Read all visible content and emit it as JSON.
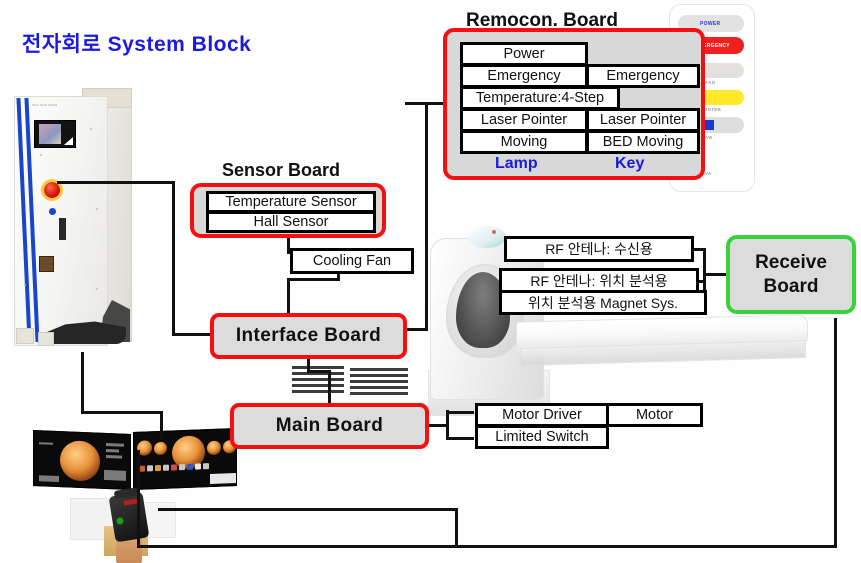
{
  "title": "전자회로 System Block",
  "boards": {
    "remocon": {
      "header": "Remocon. Board",
      "lamp_label": "Lamp",
      "key_label": "Key",
      "rows": [
        {
          "lamp": "Power",
          "key": ""
        },
        {
          "lamp": "Emergency",
          "key": "Emergency"
        },
        {
          "lamp": "Temperature:4-Step",
          "key": ""
        },
        {
          "lamp": "Laser Pointer",
          "key": "Laser Pointer"
        },
        {
          "lamp": "Moving",
          "key": "BED  Moving"
        }
      ]
    },
    "sensor": {
      "header": "Sensor Board",
      "items": [
        "Temperature Sensor",
        "Hall Sensor"
      ]
    },
    "cooling_fan": "Cooling Fan",
    "interface": "Interface Board",
    "main": "Main Board",
    "receive": "Receive\nBoard",
    "receive_line1": "Receive",
    "receive_line2": "Board"
  },
  "rf_group": [
    "RF 안테나: 수신용",
    "RF 안테나: 위치 분석용",
    "위치 분석용 Magnet Sys."
  ],
  "motor_group": {
    "driver": "Motor Driver",
    "motor": "Motor",
    "limit": "Limited Switch"
  },
  "remote_photo": {
    "keys": [
      {
        "text": "POWER",
        "label": ""
      },
      {
        "text": "EMERGENCY",
        "label": ""
      },
      {
        "text": "",
        "label": "COOLING FAN"
      },
      {
        "text": "",
        "label": "LASER POINTER"
      },
      {
        "text": "",
        "label": "TABLE MOVE"
      },
      {
        "text": "",
        "label": "VIVA"
      }
    ]
  },
  "colors": {
    "title_blue": "#1a1ae0",
    "board_red": "#f41010",
    "board_green": "#3ad23a",
    "board_fill": "#dcdcdc",
    "line_black": "#111111"
  }
}
